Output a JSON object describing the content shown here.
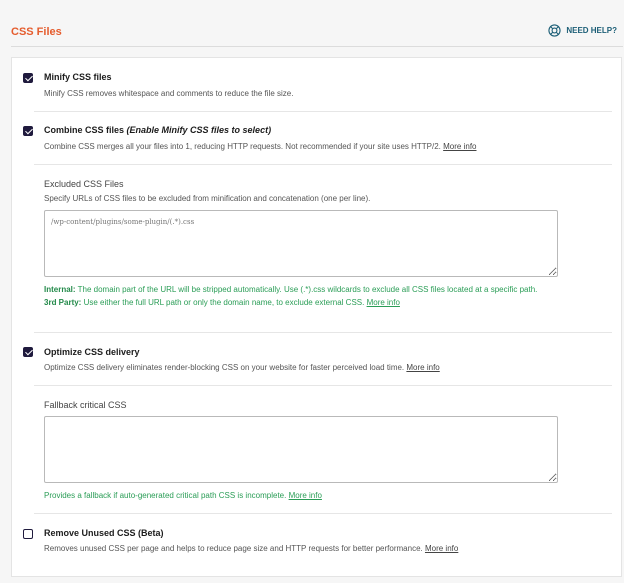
{
  "header": {
    "title": "CSS Files",
    "help_label": "NEED HELP?"
  },
  "colors": {
    "title_accent": "#e55c2d",
    "help": "#1d5f77",
    "checkbox": "#1f1a3d",
    "note_green": "#2a9d56"
  },
  "icons": {
    "help": "lifebuoy-icon",
    "checkbox_checked": "check-icon"
  },
  "options": {
    "minify": {
      "checked": true,
      "title": "Minify CSS files",
      "desc": "Minify CSS removes whitespace and comments to reduce the file size."
    },
    "combine": {
      "checked": true,
      "title": "Combine CSS files",
      "title_suffix": "(Enable Minify CSS files to select)",
      "desc": "Combine CSS merges all your files into 1, reducing HTTP requests. Not recommended if your site uses HTTP/2.",
      "more_info": "More info"
    },
    "excluded": {
      "title": "Excluded CSS Files",
      "desc": "Specify URLs of CSS files to be excluded from minification and concatenation (one per line).",
      "placeholder": "/wp-content/plugins/some-plugin/(.*).css",
      "internal_label": "Internal:",
      "internal_text": "The domain part of the URL will be stripped automatically. Use (.*).css wildcards to exclude all CSS files located at a specific path.",
      "third_party_label": "3rd Party:",
      "third_party_text": "Use either the full URL path or only the domain name, to exclude external CSS.",
      "more_info": "More info"
    },
    "optimize": {
      "checked": true,
      "title": "Optimize CSS delivery",
      "desc": "Optimize CSS delivery eliminates render-blocking CSS on your website for faster perceived load time.",
      "more_info": "More info"
    },
    "fallback": {
      "title": "Fallback critical CSS",
      "value": "",
      "note": "Provides a fallback if auto-generated critical path CSS is incomplete.",
      "more_info": "More info"
    },
    "unused": {
      "checked": false,
      "title": "Remove Unused CSS (Beta)",
      "desc": "Removes unused CSS per page and helps to reduce page size and HTTP requests for better performance.",
      "more_info": "More info"
    }
  }
}
